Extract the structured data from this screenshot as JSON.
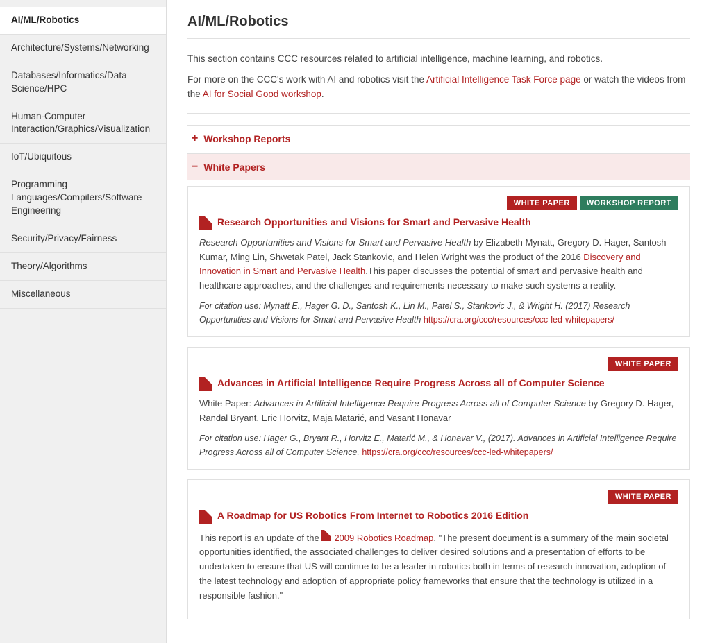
{
  "sidebar": {
    "items": [
      {
        "id": "ai-ml-robotics",
        "label": "AI/ML/Robotics",
        "active": true
      },
      {
        "id": "architecture",
        "label": "Architecture/Systems/Networking",
        "active": false
      },
      {
        "id": "databases",
        "label": "Databases/Informatics/Data Science/HPC",
        "active": false
      },
      {
        "id": "hci",
        "label": "Human-Computer Interaction/Graphics/Visualization",
        "active": false
      },
      {
        "id": "iot",
        "label": "IoT/Ubiquitous",
        "active": false
      },
      {
        "id": "programming",
        "label": "Programming Languages/Compilers/Software Engineering",
        "active": false
      },
      {
        "id": "security",
        "label": "Security/Privacy/Fairness",
        "active": false
      },
      {
        "id": "theory",
        "label": "Theory/Algorithms",
        "active": false
      },
      {
        "id": "misc",
        "label": "Miscellaneous",
        "active": false
      }
    ]
  },
  "main": {
    "title": "AI/ML/Robotics",
    "intro_line1": "This section contains CCC resources related to artificial intelligence, machine learning, and robotics.",
    "intro_line2_prefix": "For more on the CCC's work with AI and robotics visit the ",
    "intro_link1_text": "Artificial Intelligence Task Force page",
    "intro_link1_href": "#",
    "intro_line2_middle": " or watch the videos from the ",
    "intro_link2_text": "AI for Social Good workshop",
    "intro_link2_href": "#",
    "intro_line2_suffix": ".",
    "accordion_workshop": {
      "label": "Workshop Reports",
      "expanded": false,
      "icon": "+"
    },
    "accordion_white_papers": {
      "label": "White Papers",
      "expanded": true,
      "icon": "−"
    },
    "papers": [
      {
        "id": "paper1",
        "badges": [
          "WHITE PAPER",
          "WORKSHOP REPORT"
        ],
        "badge_types": [
          "white-paper",
          "workshop-report"
        ],
        "title": "Research Opportunities and Visions for Smart and Pervasive Health",
        "body_italic": "Research Opportunities and Visions for Smart and Pervasive Health",
        "body_text1": " by Elizabeth Mynatt, Gregory D. Hager, Santosh Kumar, Ming Lin, Shwetak Patel, Jack Stankovic, and Helen Wright was the product of the 2016 ",
        "body_link_text": "Discovery and Innovation in Smart and Pervasive Health",
        "body_link_href": "#",
        "body_text2": ".This paper discusses the potential of smart and pervasive health and healthcare approaches, and the challenges and requirements necessary to make such systems a reality.",
        "citation_label": "For citation use:",
        "citation_text": " Mynatt E., Hager G. D., Santosh K., Lin M., Patel S., Stankovic J., & Wright H. (2017) ",
        "citation_italic": "Research Opportunities and Visions for Smart and Pervasive Health",
        "citation_url": "https://cra.org/ccc/resources/ccc-led-whitepapers/"
      },
      {
        "id": "paper2",
        "badges": [
          "WHITE PAPER"
        ],
        "badge_types": [
          "white-paper"
        ],
        "title": "Advances in Artificial Intelligence Require Progress Across all of Computer Science",
        "body_prefix": "White Paper: ",
        "body_italic": "Advances in Artificial Intelligence Require Progress Across all of Computer Science",
        "body_text1": " by Gregory D. Hager, Randal Bryant, Eric Horvitz, Maja Matarić, and Vasant Honavar",
        "citation_text": "For citation use: Hager G., Bryant R., Horvitz E., Matarić M., & Honavar V., (2017). Advances in Artificial Intelligence Require Progress Across all of Computer Science. ",
        "citation_url": "https://cra.org/ccc/resources/ccc-led-whitepapers/"
      },
      {
        "id": "paper3",
        "badges": [
          "WHITE PAPER"
        ],
        "badge_types": [
          "white-paper"
        ],
        "title": "A Roadmap for US Robotics From Internet to Robotics 2016 Edition",
        "body_text1": "This report is an update of the ",
        "body_link_text": "2009 Robotics Roadmap",
        "body_link_href": "#",
        "body_text2": ". \"The present document is a summary of the main societal opportunities identified, the associated challenges to deliver desired solutions and a presentation of efforts to be undertaken to ensure that US will continue to be a leader in robotics both in terms of research innovation, adoption of the latest technology and adoption of appropriate policy frameworks that ensure that the technology is utilized in a responsible fashion.\""
      }
    ]
  }
}
